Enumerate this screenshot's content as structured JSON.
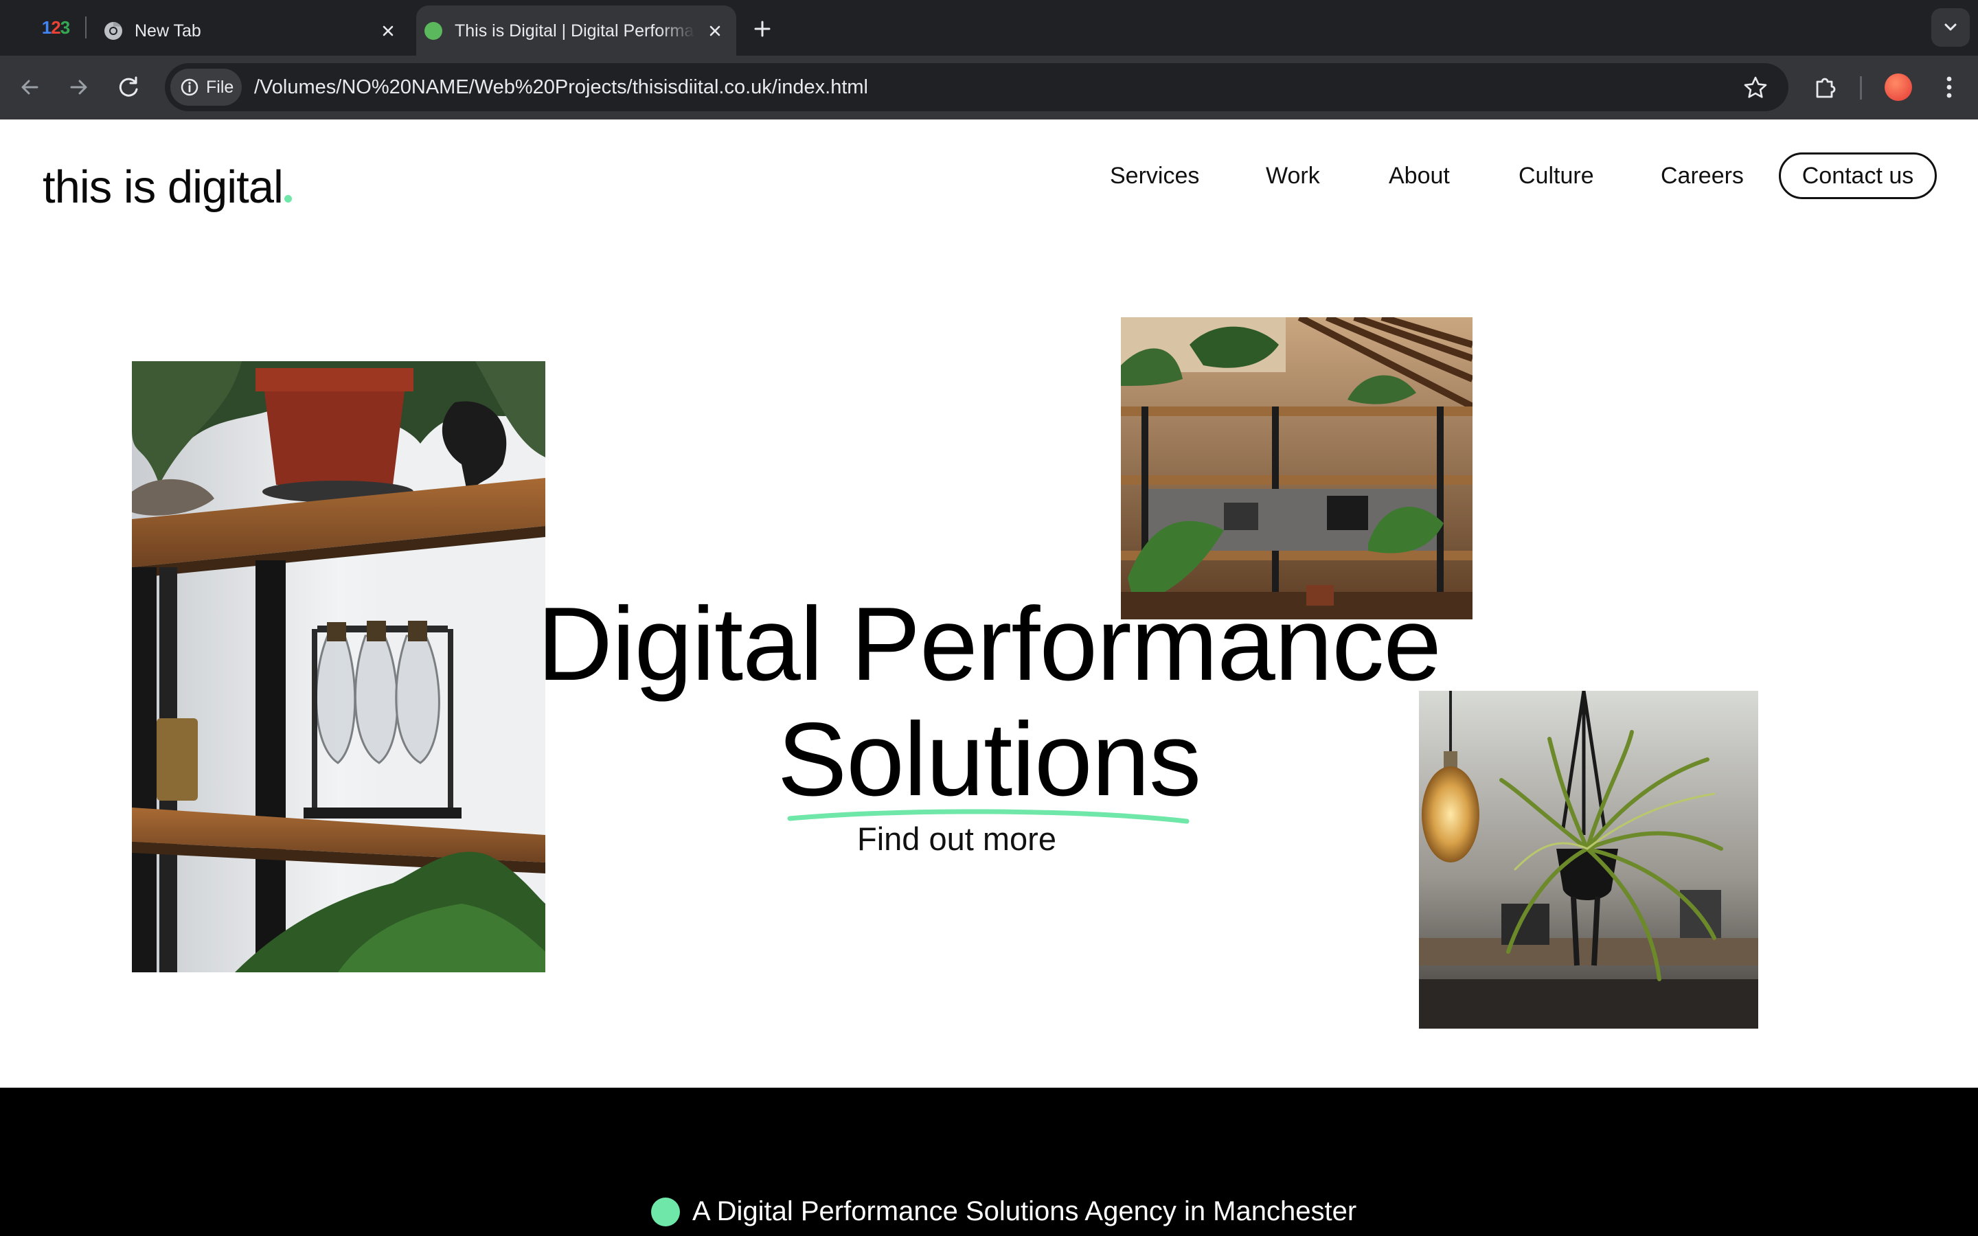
{
  "browser": {
    "pinned_tab_label": "123",
    "tabs": [
      {
        "title": "New Tab",
        "state": "inactive"
      },
      {
        "title": "This is Digital | Digital Performance Solutions",
        "state": "active"
      }
    ],
    "file_chip_label": "File",
    "url": "/Volumes/NO%20NAME/Web%20Projects/thisisdiital.co.uk/index.html",
    "colors": {
      "tabbar": "#202124",
      "toolbar": "#35363a",
      "active_favicon": "#5cb85c"
    }
  },
  "site": {
    "logo_text": "this is digital",
    "nav": [
      "Services",
      "Work",
      "About",
      "Culture",
      "Careers"
    ],
    "contact_label": "Contact us",
    "hero": {
      "line1": "Digital Performance",
      "line2": "Solutions",
      "cta": "Find out more"
    },
    "tagline": "A Digital Performance Solutions Agency in Manchester",
    "accent_color": "#6ee7a8"
  }
}
